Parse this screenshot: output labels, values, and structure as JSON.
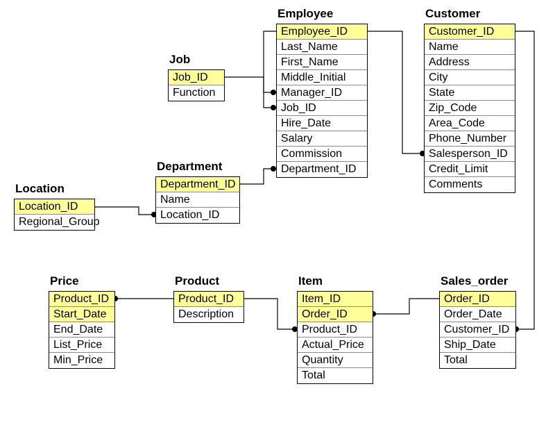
{
  "entities": {
    "employee": {
      "title": "Employee",
      "fields": [
        "Employee_ID",
        "Last_Name",
        "First_Name",
        "Middle_Initial",
        "Manager_ID",
        "Job_ID",
        "Hire_Date",
        "Salary",
        "Commission",
        "Department_ID"
      ],
      "pk_count": 1
    },
    "customer": {
      "title": "Customer",
      "fields": [
        "Customer_ID",
        "Name",
        "Address",
        "City",
        "State",
        "Zip_Code",
        "Area_Code",
        "Phone_Number",
        "Salesperson_ID",
        "Credit_Limit",
        "Comments"
      ],
      "pk_count": 1
    },
    "job": {
      "title": "Job",
      "fields": [
        "Job_ID",
        "Function"
      ],
      "pk_count": 1
    },
    "department": {
      "title": "Department",
      "fields": [
        "Department_ID",
        "Name",
        "Location_ID"
      ],
      "pk_count": 1
    },
    "location": {
      "title": "Location",
      "fields": [
        "Location_ID",
        "Regional_Group"
      ],
      "pk_count": 1
    },
    "price": {
      "title": "Price",
      "fields": [
        "Product_ID",
        "Start_Date",
        "End_Date",
        "List_Price",
        "Min_Price"
      ],
      "pk_count": 2
    },
    "product": {
      "title": "Product",
      "fields": [
        "Product_ID",
        "Description"
      ],
      "pk_count": 1
    },
    "item": {
      "title": "Item",
      "fields": [
        "Item_ID",
        "Order_ID",
        "Product_ID",
        "Actual_Price",
        "Quantity",
        "Total"
      ],
      "pk_count": 2
    },
    "sales_order": {
      "title": "Sales_order",
      "fields": [
        "Order_ID",
        "Order_Date",
        "Customer_ID",
        "Ship_Date",
        "Total"
      ],
      "pk_count": 1
    }
  }
}
